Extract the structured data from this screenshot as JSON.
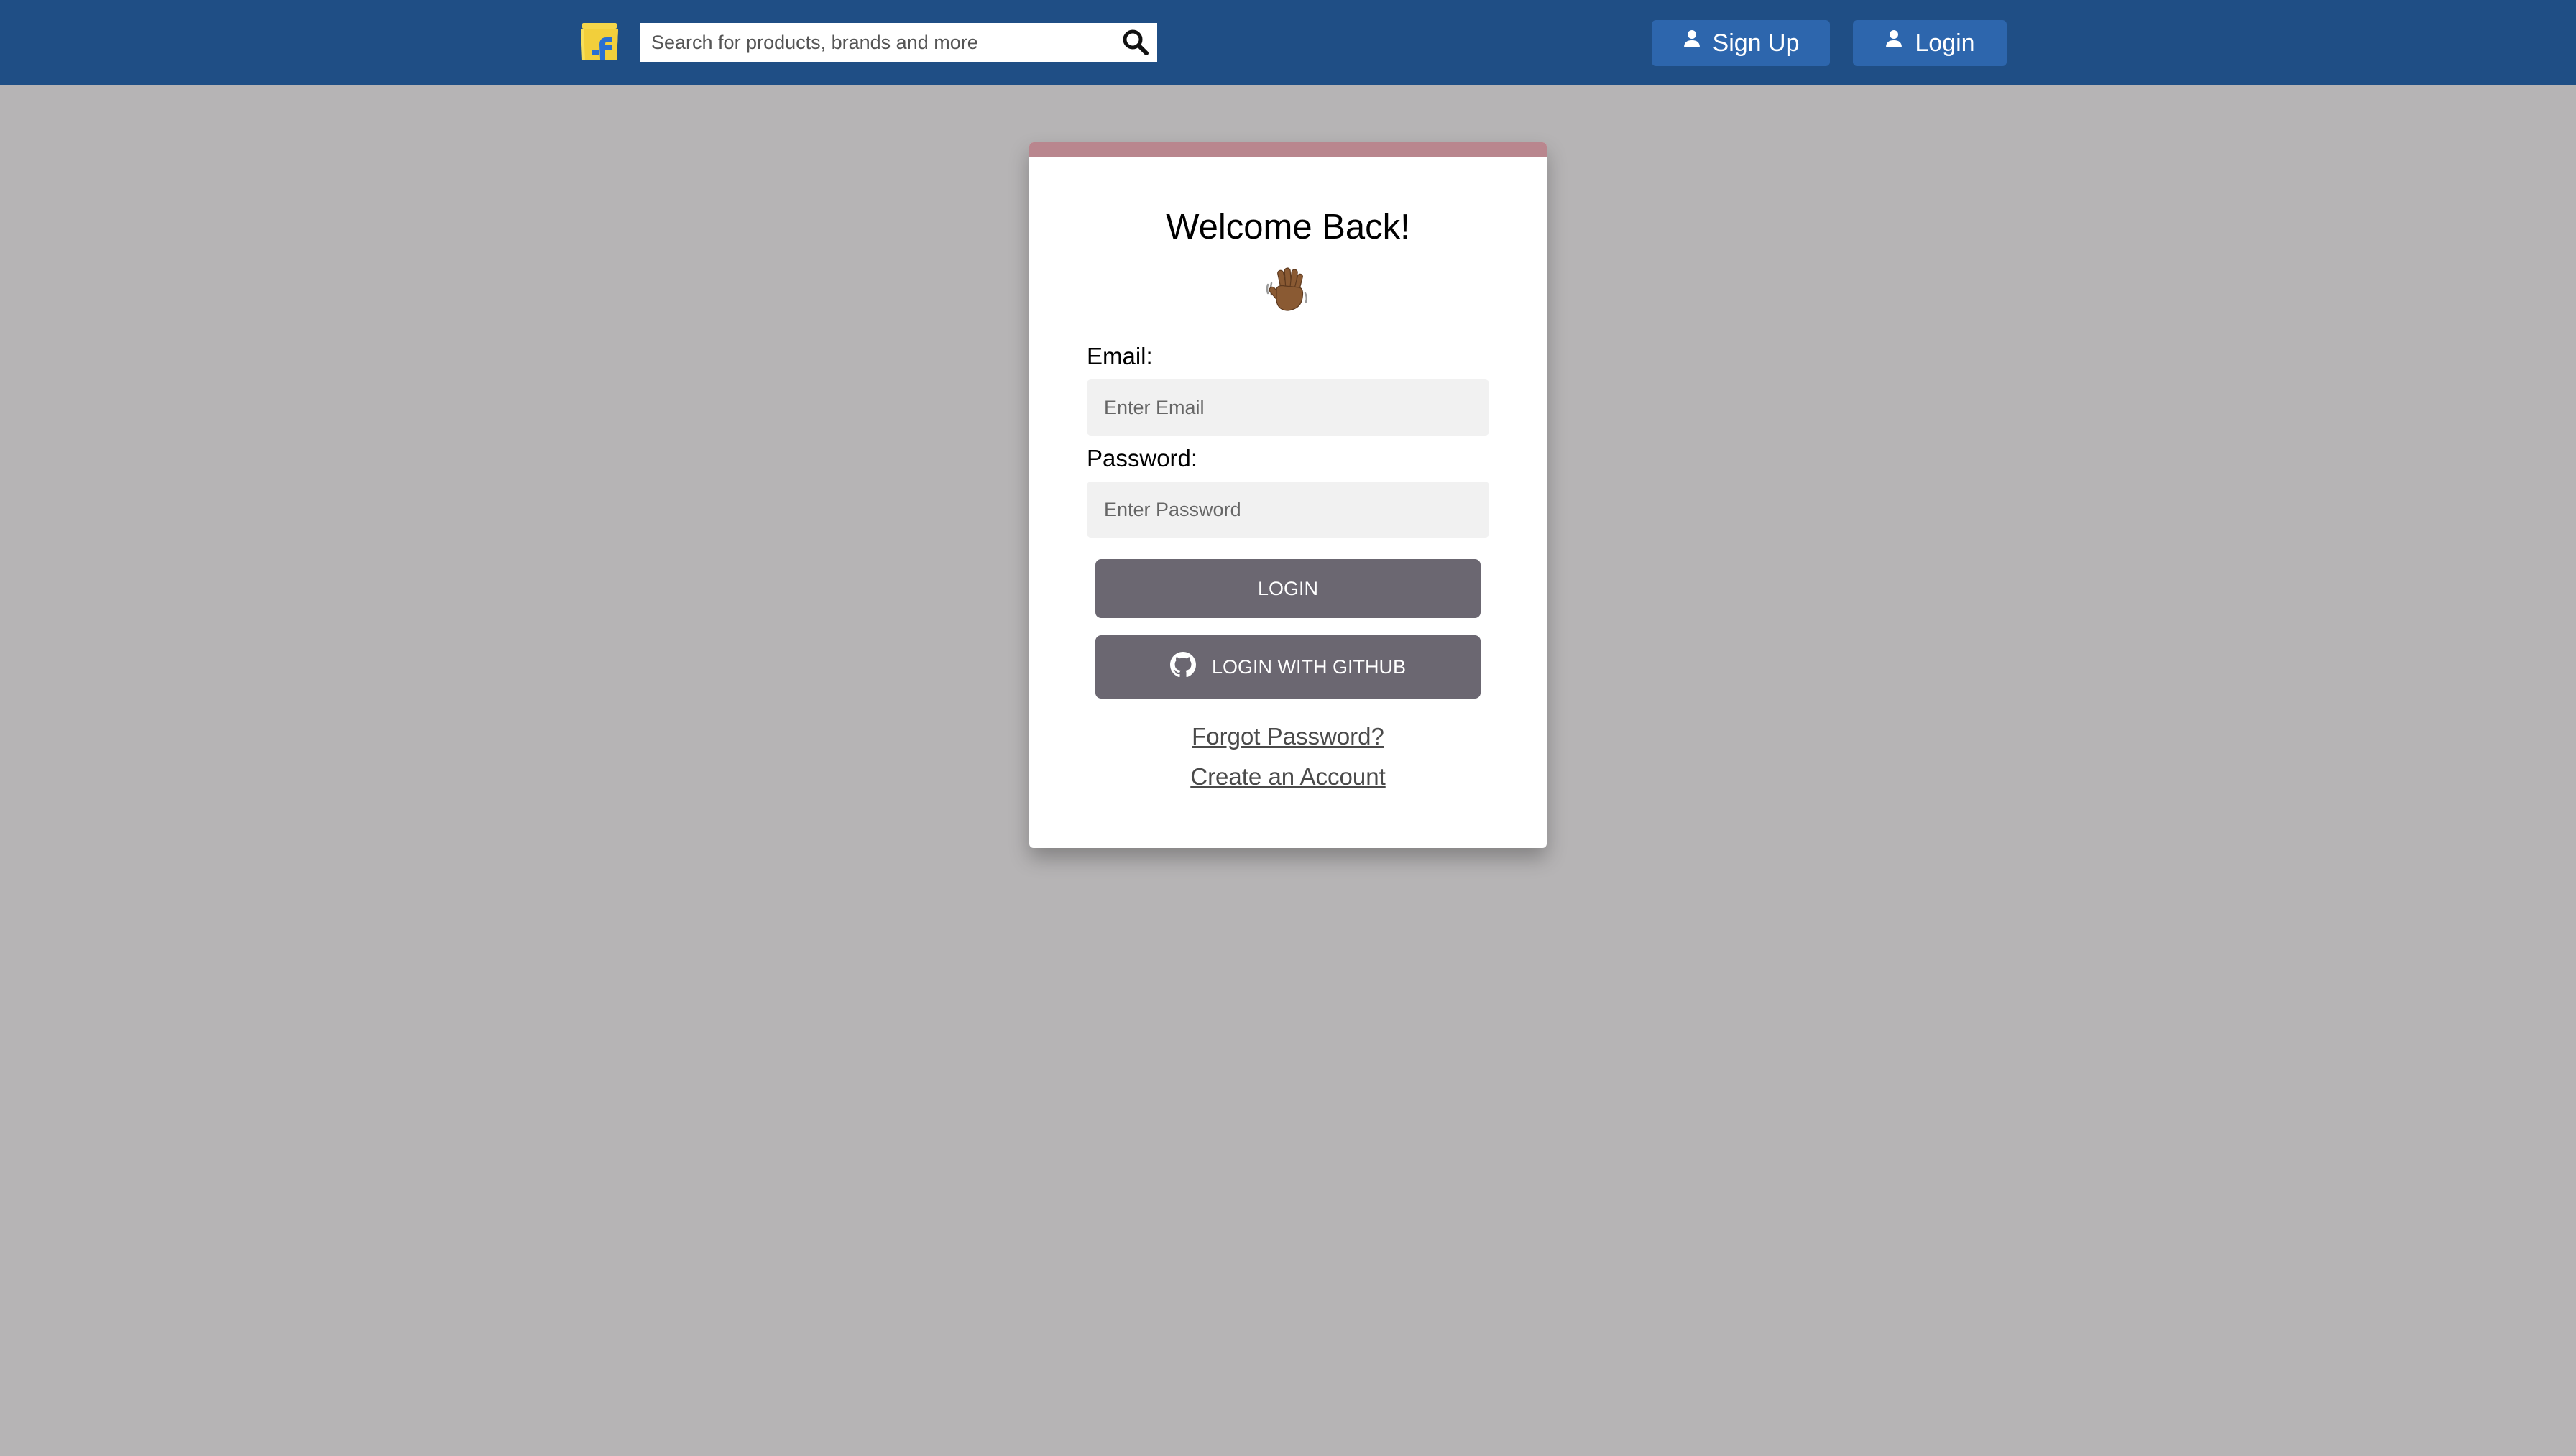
{
  "header": {
    "search": {
      "placeholder": "Search for products, brands and more",
      "value": ""
    },
    "logo_icon": "shopping-bag-logo",
    "search_icon": "magnifier-icon",
    "signup_label": "Sign Up",
    "login_label": "Login",
    "user_icon": "user-icon"
  },
  "login_card": {
    "title": "Welcome Back!",
    "wave_icon": "waving-hand-emoji",
    "email_label": "Email:",
    "email_placeholder": "Enter Email",
    "email_value": "",
    "password_label": "Password:",
    "password_placeholder": "Enter Password",
    "password_value": "",
    "login_button": "Login",
    "github_button": "Login with GitHub",
    "github_icon": "github-icon",
    "forgot_link": "Forgot Password?",
    "create_link": "Create an Account"
  },
  "colors": {
    "header_bg": "#1f4e85",
    "nav_button_bg": "#2d66ad",
    "page_bg": "#b6b4b5",
    "card_accent": "#b9868e",
    "action_button_bg": "#6b6771",
    "input_bg": "#f1f1f1"
  }
}
